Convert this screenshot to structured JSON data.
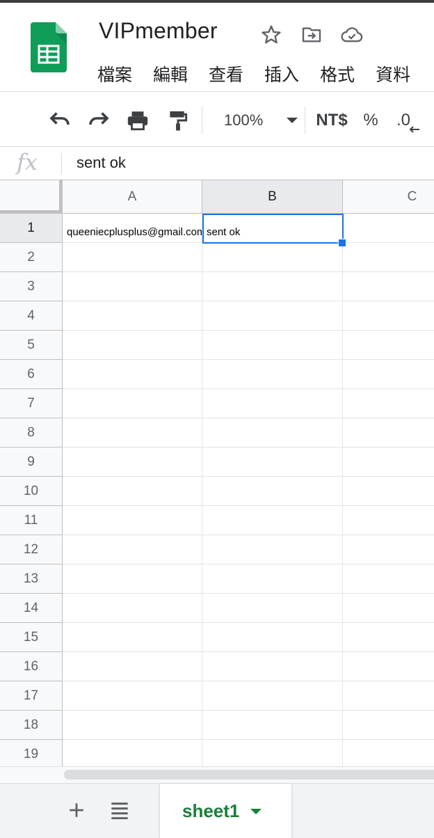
{
  "app": {
    "doc_title": "VIPmember",
    "logo_icon": "google-sheets-logo",
    "brand_color": "#0f9d58",
    "accent_color": "#1a73e8"
  },
  "title_icons": [
    "star-icon",
    "move-to-folder-icon",
    "cloud-saved-icon"
  ],
  "menu": [
    "檔案",
    "編輯",
    "查看",
    "插入",
    "格式",
    "資料"
  ],
  "toolbar": {
    "buttons": [
      "undo-icon",
      "redo-icon",
      "print-icon",
      "paint-format-icon"
    ],
    "zoom": "100%",
    "currency": "NT$",
    "percent": "%",
    "decimal_decrease": ".0"
  },
  "formula_bar": {
    "fx_label": "fx",
    "value": "sent ok"
  },
  "grid": {
    "columns": [
      "A",
      "B",
      "C"
    ],
    "selected_column": "B",
    "rows": [
      "1",
      "2",
      "3",
      "4",
      "5",
      "6",
      "7",
      "8",
      "9",
      "10",
      "11",
      "12",
      "13",
      "14",
      "15",
      "16",
      "17",
      "18",
      "19"
    ],
    "selected_row": "1",
    "cells": {
      "A1": "queeniecplusplus@gmail.com",
      "B1": "sent ok"
    },
    "active_cell": "B1"
  },
  "sheet_tabs": {
    "add_icon": "plus-icon",
    "list_icon": "all-sheets-icon",
    "tabs": [
      {
        "label": "sheet1",
        "active": true
      }
    ]
  }
}
